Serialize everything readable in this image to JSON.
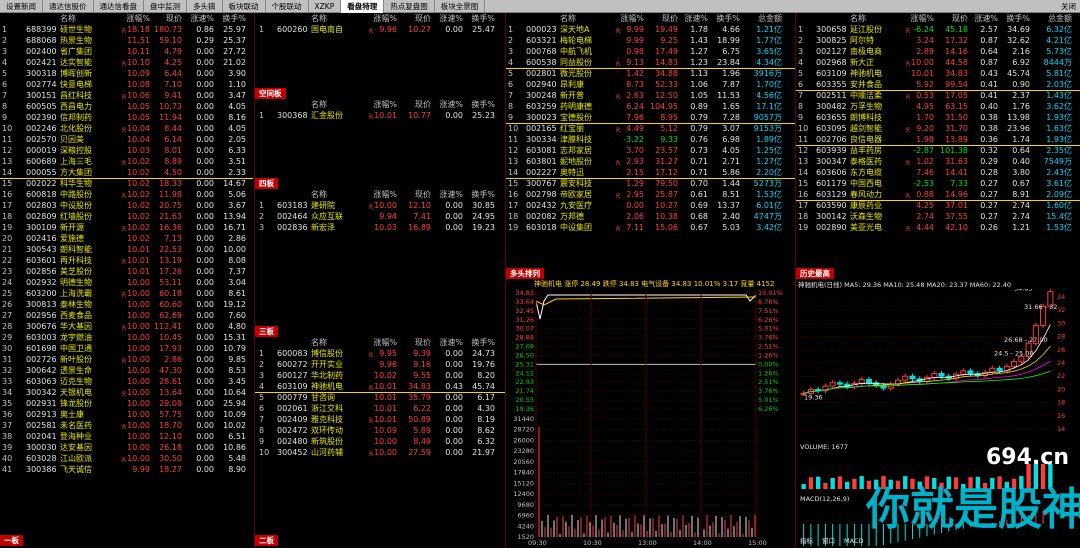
{
  "tabs": [
    "设置新闻",
    "通达信股价",
    "通达信看盘",
    "盘中监测",
    "多头搞",
    "板块联动",
    "个股联动",
    "XZKP",
    "看盘特理",
    "热点复盘图",
    "板块全景图"
  ],
  "active_tab": "看盘特理",
  "close_label": "关闭",
  "cols": {
    "name": "名称",
    "chg": "涨幅%",
    "prc": "现价",
    "spd": "涨速%",
    "trn": "换手%",
    "cap": "总金额"
  },
  "panel_a": {
    "label": "一板",
    "rows": [
      [
        "1",
        "688399",
        "硕世生物",
        "18.18",
        "180.73",
        "0.86",
        "25.97"
      ],
      [
        "2",
        "688068",
        "热景生物",
        "11.51",
        "59.10",
        "0.29",
        "25.37"
      ],
      [
        "3",
        "002400",
        "省广集团",
        "10.11",
        "4.79",
        "0.00",
        "27.72"
      ],
      [
        "4",
        "002421",
        "达实智能",
        "10.10",
        "4.25",
        "0.00",
        "21.02"
      ],
      [
        "5",
        "300318",
        "博晖创新",
        "10.09",
        "6.44",
        "0.00",
        "3.90"
      ],
      [
        "6",
        "002774",
        "快意电梯",
        "10.08",
        "7.10",
        "0.00",
        "1.10"
      ],
      [
        "7",
        "300151",
        "昌红科技",
        "10.06",
        "9.41",
        "0.00",
        "3.47"
      ],
      [
        "8",
        "600505",
        "西昌电力",
        "10.05",
        "10.73",
        "0.00",
        "4.05"
      ],
      [
        "9",
        "002390",
        "信邦制药",
        "10.05",
        "11.94",
        "0.00",
        "8.16"
      ],
      [
        "10",
        "002246",
        "北化股份",
        "10.04",
        "8.44",
        "0.00",
        "4.05"
      ],
      [
        "11",
        "002570",
        "贝因美",
        "10.04",
        "6.14",
        "0.00",
        "2.05"
      ],
      [
        "12",
        "000019",
        "深粮控股",
        "10.03",
        "8.01",
        "0.00",
        "6.33"
      ],
      [
        "13",
        "600689",
        "上海三毛",
        "10.02",
        "8.89",
        "0.00",
        "3.51"
      ],
      [
        "14",
        "000055",
        "方大集团",
        "10.02",
        "4.50",
        "0.00",
        "2.33"
      ],
      [
        "15",
        "002022",
        "科华生物",
        "10.02",
        "18.33",
        "0.00",
        "14.67"
      ],
      [
        "16",
        "600818",
        "中路股份",
        "10.02",
        "11.98",
        "0.00",
        "5.06"
      ],
      [
        "17",
        "002803",
        "中设股份",
        "10.02",
        "20.75",
        "0.00",
        "3.67"
      ],
      [
        "18",
        "002809",
        "红墙股份",
        "10.02",
        "21.63",
        "0.00",
        "13.94"
      ],
      [
        "19",
        "300109",
        "新开源",
        "10.02",
        "16.36",
        "0.00",
        "16.71"
      ],
      [
        "20",
        "002416",
        "爱施德",
        "10.02",
        "7.13",
        "0.00",
        "2.86"
      ],
      [
        "21",
        "300543",
        "朗科智能",
        "10.01",
        "22.53",
        "0.00",
        "10.00"
      ],
      [
        "22",
        "603601",
        "再升科技",
        "10.01",
        "13.19",
        "0.00",
        "8.08"
      ],
      [
        "23",
        "002856",
        "美芝股份",
        "10.01",
        "17.26",
        "0.00",
        "7.37"
      ],
      [
        "24",
        "002932",
        "明德生物",
        "10.00",
        "53.11",
        "0.00",
        "3.04"
      ],
      [
        "25",
        "603200",
        "上海洗霸",
        "10.00",
        "60.18",
        "0.00",
        "8.61"
      ],
      [
        "26",
        "300813",
        "泰林生物",
        "10.00",
        "60.60",
        "0.00",
        "19.12"
      ],
      [
        "27",
        "002956",
        "西麦食品",
        "10.00",
        "62.69",
        "0.00",
        "7.60"
      ],
      [
        "28",
        "300676",
        "华大基因",
        "10.00",
        "112.41",
        "0.00",
        "4.80"
      ],
      [
        "29",
        "603003",
        "龙宇燃油",
        "10.00",
        "10.45",
        "0.00",
        "15.31"
      ],
      [
        "30",
        "601698",
        "中国卫通",
        "10.00",
        "17.93",
        "0.00",
        "10.79"
      ],
      [
        "31",
        "002726",
        "新叶股份",
        "10.00",
        "2.86",
        "0.00",
        "9.85"
      ],
      [
        "32",
        "300642",
        "透景生命",
        "10.00",
        "47.30",
        "0.00",
        "8.53"
      ],
      [
        "33",
        "603063",
        "迈克生物",
        "10.00",
        "28.61",
        "0.00",
        "3.45"
      ],
      [
        "34",
        "300342",
        "天银机电",
        "10.00",
        "13.64",
        "0.00",
        "10.64"
      ],
      [
        "35",
        "002931",
        "锋龙股份",
        "10.00",
        "29.08",
        "0.00",
        "25.94"
      ],
      [
        "36",
        "002913",
        "奥士康",
        "10.00",
        "57.75",
        "0.00",
        "10.09"
      ],
      [
        "37",
        "002581",
        "未名医药",
        "10.00",
        "18.70",
        "0.00",
        "10.02"
      ],
      [
        "38",
        "002041",
        "登海种业",
        "10.00",
        "12.10",
        "0.00",
        "6.51"
      ],
      [
        "39",
        "300030",
        "达安基因",
        "10.00",
        "26.18",
        "0.00",
        "10.86"
      ],
      [
        "40",
        "603028",
        "江山欧派",
        "10.00",
        "30.50",
        "0.00",
        "5.48"
      ],
      [
        "41",
        "300386",
        "飞天诚信",
        "9.99",
        "18.27",
        "0.00",
        "8.90"
      ]
    ]
  },
  "panel_b": {
    "label_top": "二板",
    "top_rows": [
      [
        "1",
        "600260",
        "国电南自",
        "9.96",
        "10.27",
        "0.00",
        "25.47"
      ]
    ],
    "s2_label": "空间板",
    "s2_rows": [
      [
        "1",
        "300368",
        "汇金股份",
        "10.01",
        "10.77",
        "0.00",
        "25.23"
      ]
    ],
    "s3_label": "四板",
    "s3_rows": [
      [
        "1",
        "603183",
        "建研院",
        "10.00",
        "12.10",
        "0.00",
        "30.85"
      ],
      [
        "2",
        "002464",
        "众应互联",
        "9.94",
        "7.41",
        "0.00",
        "24.95"
      ],
      [
        "3",
        "002836",
        "新宏泽",
        "10.03",
        "16.89",
        "0.00",
        "19.23"
      ]
    ],
    "s4_label": "三板",
    "s4_rows": [
      [
        "1",
        "600083",
        "博信股份",
        "9.95",
        "9.39",
        "0.00",
        "24.73"
      ],
      [
        "2",
        "600272",
        "开开实业",
        "9.96",
        "9.16",
        "0.00",
        "19.76"
      ],
      [
        "3",
        "600127",
        "华北制药",
        "10.02",
        "9.55",
        "0.00",
        "8.20"
      ],
      [
        "4",
        "603109",
        "神驰机电",
        "10.01",
        "34.83",
        "0.43",
        "45.74"
      ],
      [
        "5",
        "000779",
        "甘咨询",
        "10.01",
        "35.79",
        "0.00",
        "6.17"
      ],
      [
        "6",
        "002061",
        "浙江交科",
        "10.01",
        "6.22",
        "0.00",
        "4.30"
      ],
      [
        "7",
        "002409",
        "雅克科技",
        "10.01",
        "50.89",
        "0.00",
        "8.19"
      ],
      [
        "8",
        "002472",
        "双环传动",
        "10.09",
        "5.89",
        "0.00",
        "8.62"
      ],
      [
        "9",
        "002480",
        "新筑股份",
        "10.00",
        "8.49",
        "0.00",
        "6.32"
      ],
      [
        "10",
        "300452",
        "山河药辅",
        "10.00",
        "27.59",
        "0.00",
        "21.97"
      ]
    ],
    "bottom_label": "二板"
  },
  "panel_c": {
    "rows": [
      [
        "1",
        "000023",
        "深天地A",
        "9.99",
        "19.49",
        "1.78",
        "4.66",
        "1.21亿"
      ],
      [
        "2",
        "603321",
        "梅轮电梯",
        "9.99",
        "9.25",
        "1.43",
        "18.99",
        "1.77亿"
      ],
      [
        "3",
        "000768",
        "中航飞机",
        "0.98",
        "17.49",
        "1.27",
        "6.75",
        "3.65亿"
      ],
      [
        "4",
        "600538",
        "同益股份",
        "9.13",
        "14.83",
        "1.23",
        "23.84",
        "4.34亿"
      ],
      [
        "5",
        "002801",
        "微光股份",
        "1.42",
        "34.88",
        "1.13",
        "1.96",
        "3916万"
      ],
      [
        "6",
        "002940",
        "昂利康",
        "8.73",
        "52.33",
        "1.06",
        "7.87",
        "1.70亿"
      ],
      [
        "7",
        "300248",
        "新开普",
        "2.63",
        "12.50",
        "1.05",
        "11.53",
        "4.56亿"
      ],
      [
        "8",
        "603259",
        "药明康德",
        "6.24",
        "104.95",
        "0.89",
        "1.65",
        "17.1亿"
      ],
      [
        "9",
        "300023",
        "宝德股份",
        "7.96",
        "8.95",
        "0.79",
        "7.28",
        "9057万"
      ],
      [
        "10",
        "002165",
        "红宝丽",
        "4.49",
        "5.12",
        "0.79",
        "3.07",
        "9153万"
      ],
      [
        "11",
        "300334",
        "津膜科技",
        "-3.22",
        "9.33",
        "0.76",
        "6.98",
        "1.89亿"
      ],
      [
        "12",
        "603081",
        "志邦家居",
        "3.70",
        "23.57",
        "0.73",
        "4.05",
        "1.25亿"
      ],
      [
        "13",
        "603801",
        "妮地股份",
        "2.93",
        "31.27",
        "0.71",
        "2.71",
        "1.27亿"
      ],
      [
        "14",
        "002227",
        "奥特迅",
        "2.15",
        "17.12",
        "0.71",
        "5.86",
        "2.20亿"
      ],
      [
        "15",
        "300767",
        "震安科技",
        "1.29",
        "79.50",
        "0.70",
        "1.44",
        "5273万"
      ],
      [
        "16",
        "002798",
        "帝欧家居",
        "2.95",
        "25.87",
        "0.61",
        "8.51",
        "1.53亿"
      ],
      [
        "17",
        "002432",
        "九安医疗",
        "0.00",
        "10.27",
        "0.69",
        "13.37",
        "6.01亿"
      ],
      [
        "18",
        "002082",
        "万邦德",
        "2.06",
        "10.38",
        "0.68",
        "2.40",
        "4747万"
      ],
      [
        "19",
        "603018",
        "中设集团",
        "7.11",
        "15.06",
        "0.67",
        "5.03",
        "3.42亿"
      ]
    ],
    "chart_label": "多头排列",
    "chart_header": "神驰机电  涨停 28.49 跌停 34.83  电气设备 34.83 10.01% 3.17 竞量 4152",
    "y_left": [
      "34.83",
      "33.64",
      "32.45",
      "31.26",
      "30.07",
      "28.88",
      "27.69",
      "26.50",
      "25.31",
      "24.12",
      "22.93",
      "21.74",
      "20.55",
      "19.36"
    ],
    "y_right": [
      "10.01%",
      "8.76%",
      "7.51%",
      "6.26%",
      "5.01%",
      "3.76%",
      "2.51%",
      "1.26%",
      "0.00%",
      "1.26%",
      "2.51%",
      "3.76%",
      "5.01%",
      "6.26%"
    ],
    "vol_left": [
      "31440",
      "28720",
      "26000",
      "23280",
      "20560",
      "17840",
      "15120",
      "12400",
      "9680",
      "6960",
      "4240",
      "1520"
    ],
    "x_ticks": [
      "09:30",
      "10:30",
      "13:00",
      "14:00",
      "15:00"
    ]
  },
  "panel_d": {
    "rows": [
      [
        "1",
        "300658",
        "延江股份",
        "-6.24",
        "45.18",
        "2.57",
        "34.69",
        "6.32亿"
      ],
      [
        "2",
        "300825",
        "阿尔特",
        "3.24",
        "17.32",
        "0.87",
        "32.62",
        "4.21亿"
      ],
      [
        "3",
        "002127",
        "南极电商",
        "2.89",
        "14.16",
        "0.64",
        "2.16",
        "5.73亿"
      ],
      [
        "4",
        "002968",
        "新大正",
        "10.00",
        "44.58",
        "0.87",
        "6.92",
        "8444万"
      ],
      [
        "5",
        "603109",
        "神驰机电",
        "10.01",
        "34.83",
        "0.43",
        "45.74",
        "5.81亿"
      ],
      [
        "6",
        "603355",
        "安井食品",
        "5.92",
        "99.54",
        "0.41",
        "0.90",
        "2.03亿"
      ],
      [
        "7",
        "002511",
        "中顺洁柔",
        "0.53",
        "17.05",
        "0.41",
        "2.37",
        "1.43亿"
      ],
      [
        "8",
        "300482",
        "万孚生物",
        "4.95",
        "63.15",
        "0.40",
        "1.76",
        "3.62亿"
      ],
      [
        "9",
        "603655",
        "朗博科技",
        "1.70",
        "31.50",
        "0.38",
        "13.98",
        "1.93亿"
      ],
      [
        "10",
        "603095",
        "越剑智能",
        "9.20",
        "31.70",
        "0.38",
        "23.96",
        "1.63亿"
      ],
      [
        "11",
        "002706",
        "良信电器",
        "1.98",
        "13.89",
        "0.36",
        "1.74",
        "1.93亿"
      ],
      [
        "12",
        "603939",
        "益丰药房",
        "-2.87",
        "101.38",
        "0.32",
        "0.64",
        "2.35亿"
      ],
      [
        "13",
        "300347",
        "泰格医药",
        "1.02",
        "31.63",
        "0.29",
        "0.40",
        "7549万"
      ],
      [
        "14",
        "603606",
        "东方电缆",
        "7.46",
        "14.41",
        "0.28",
        "3.80",
        "2.43亿"
      ],
      [
        "15",
        "601179",
        "中国西电",
        "-2.53",
        "7.33",
        "0.27",
        "0.67",
        "3.61亿"
      ],
      [
        "16",
        "603129",
        "春风动力",
        "0.88",
        "14.96",
        "0.27",
        "8.91",
        "2.09亿"
      ],
      [
        "17",
        "603590",
        "康辰药业",
        "4.25",
        "37.01",
        "0.27",
        "2.74",
        "1.60亿"
      ],
      [
        "18",
        "300142",
        "沃森生物",
        "2.74",
        "37.55",
        "0.27",
        "2.74",
        "15.4亿"
      ],
      [
        "19",
        "002890",
        "美亚光电",
        "4.44",
        "42.10",
        "0.26",
        "1.21",
        "1.53亿"
      ]
    ],
    "chart_label": "历史最高",
    "kline_header": "神驰机电(日线)  MA5: 29.36  MA10: 25.48  MA20: 23.37  MA60: 22.40",
    "price_marks": [
      "34.83",
      "31.66 - 32",
      "26.68 - 27.00",
      "24.5 - 25.00",
      "19.36",
      "14.66"
    ],
    "y_ticks": [
      "34",
      "32",
      "30",
      "28",
      "26",
      "24",
      "22",
      "20",
      "18",
      "16",
      "14"
    ],
    "volume_label": "VOLUME: 1677",
    "macd_label": "MACD(12,26,9)",
    "bottom_tabs": [
      "指标",
      "窗口",
      "MACD"
    ],
    "watermark_top": "694.cn",
    "watermark_main": "你就是股神"
  }
}
